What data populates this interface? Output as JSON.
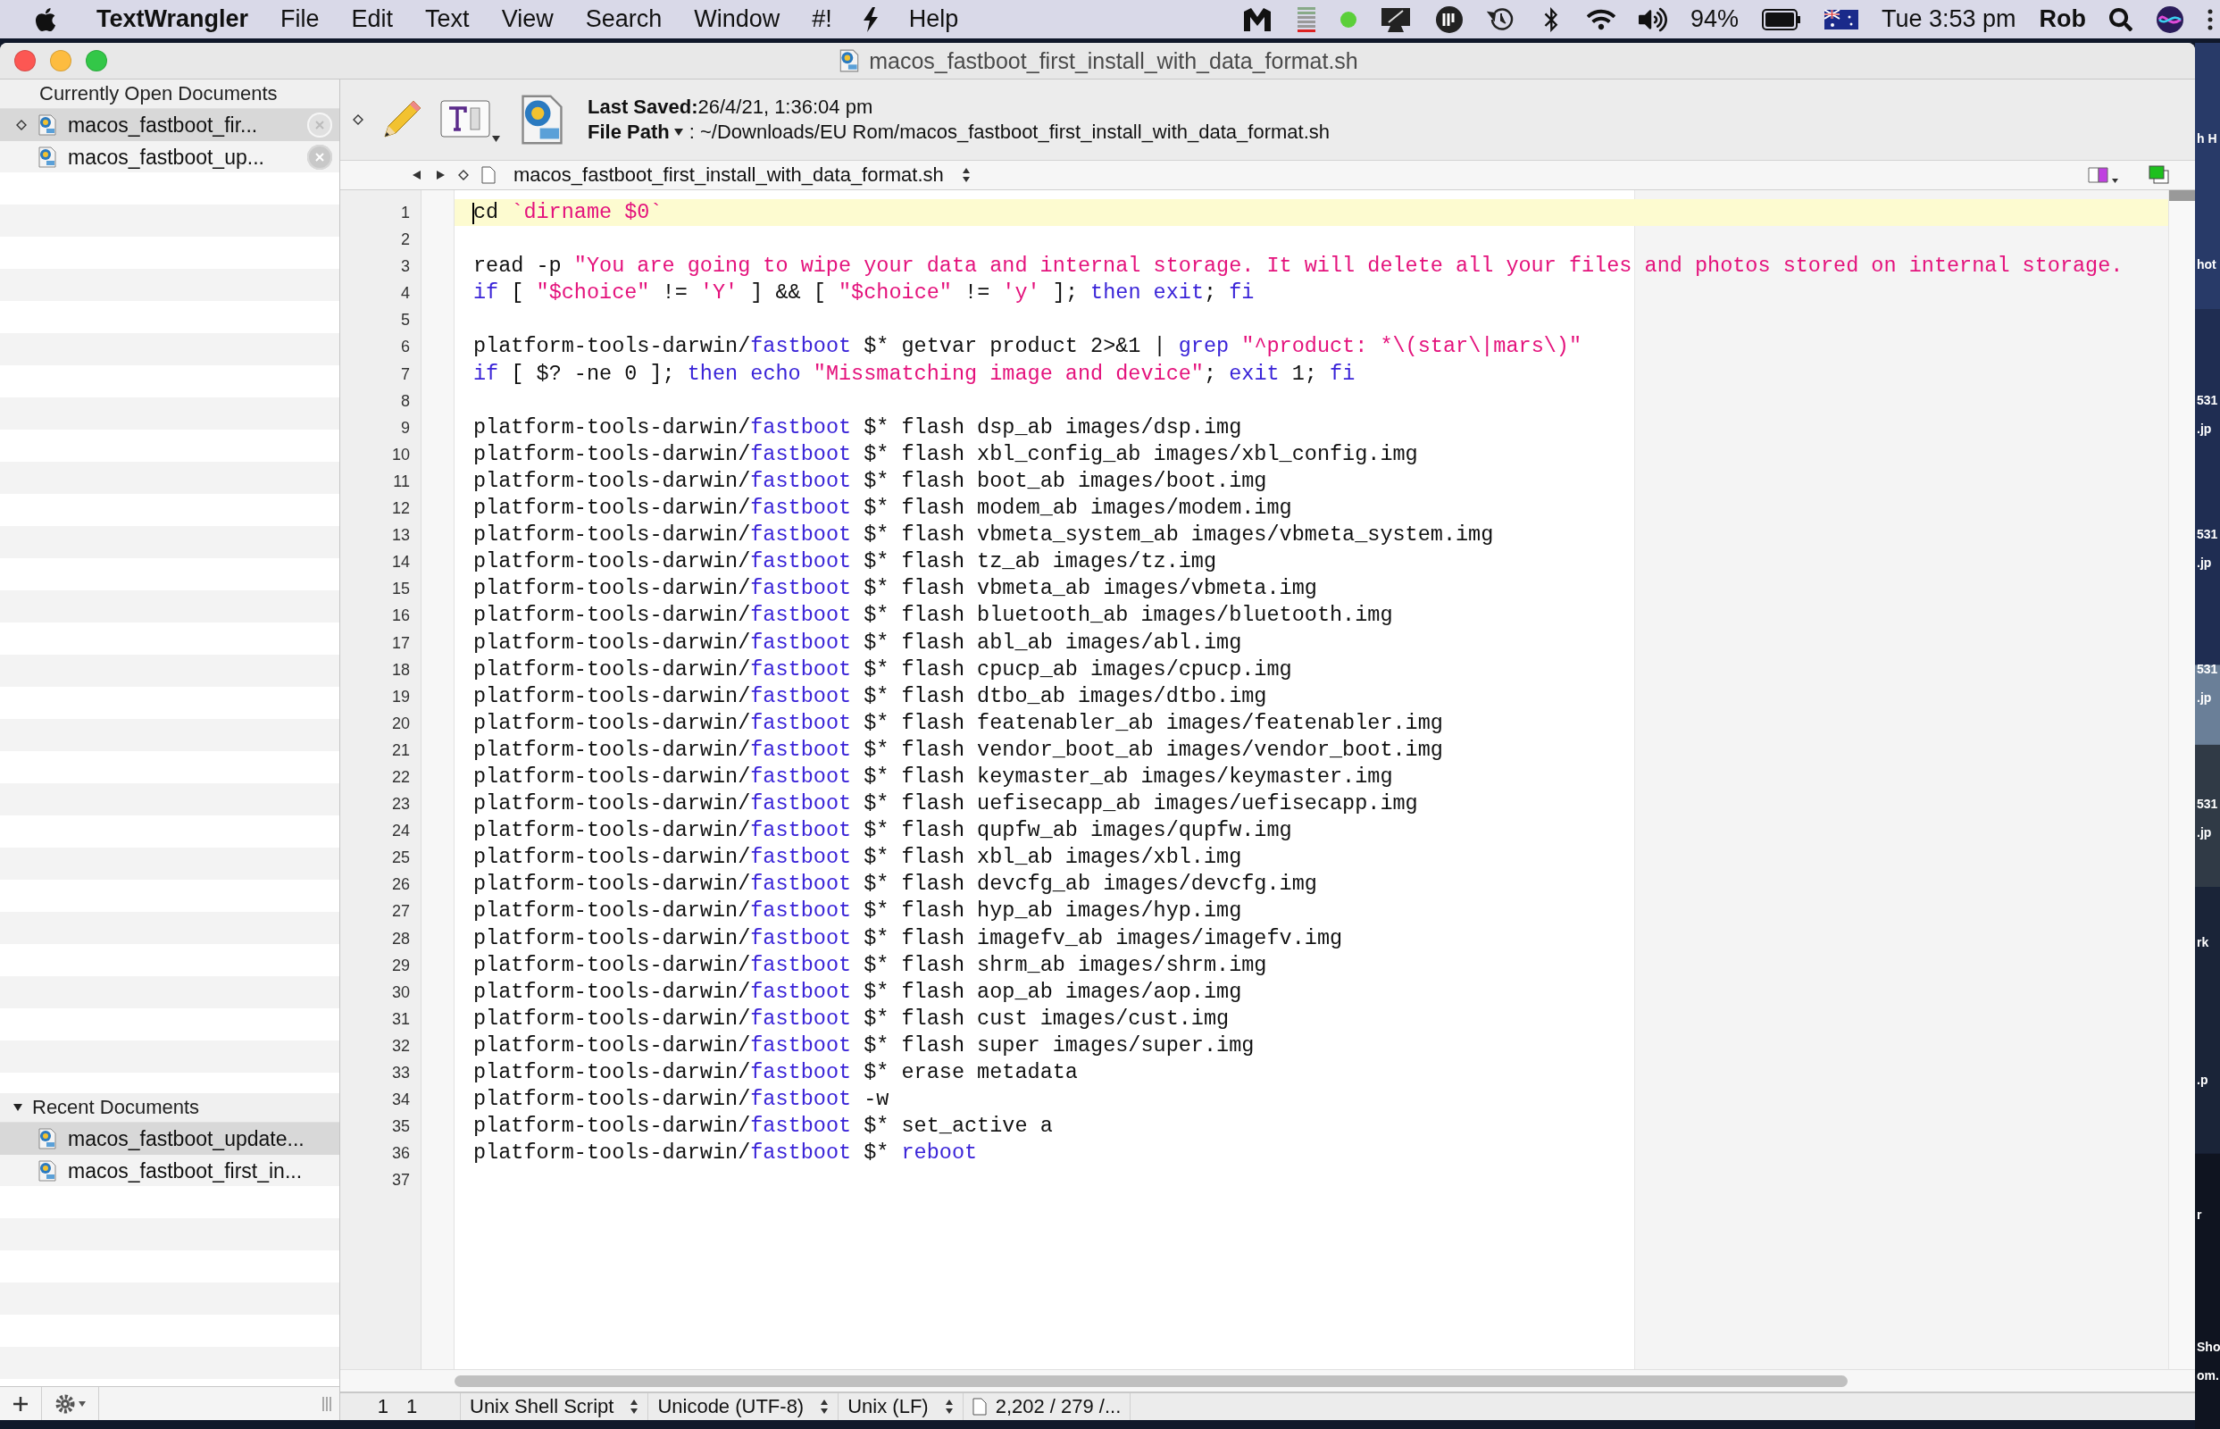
{
  "menubar": {
    "app_name": "TextWrangler",
    "menus": [
      "File",
      "Edit",
      "Text",
      "View",
      "Search",
      "Window",
      "#!"
    ],
    "help_menu": "Help",
    "battery": "94%",
    "clock": "Tue 3:53 pm",
    "user": "Rob"
  },
  "window": {
    "title": "macos_fastboot_first_install_with_data_format.sh"
  },
  "sidebar": {
    "open_header": "Currently Open Documents",
    "open_documents": [
      {
        "name": "macos_fastboot_fir...",
        "selected": true,
        "modified": true
      },
      {
        "name": "macos_fastboot_up...",
        "selected": false,
        "modified": false
      }
    ],
    "recent_header": "Recent Documents",
    "recent_expanded": true,
    "recent_documents": [
      {
        "name": "macos_fastboot_update...",
        "selected": true
      },
      {
        "name": "macos_fastboot_first_in...",
        "selected": false
      }
    ]
  },
  "toolbar": {
    "saved_label": "Last Saved:",
    "saved_value": " 26/4/21, 1:36:04 pm",
    "path_label": "File Path",
    "path_value": " : ~/Downloads/EU Rom/macos_fastboot_first_install_with_data_format.sh"
  },
  "navbar": {
    "file_name": "macos_fastboot_first_install_with_data_format.sh"
  },
  "code": [
    {
      "n": "1",
      "current": true,
      "tokens": [
        {
          "kind": "plain",
          "text": "cd "
        },
        {
          "kind": "string",
          "text": "`dirname $0`"
        }
      ]
    },
    {
      "n": "2",
      "current": false
    },
    {
      "n": "3",
      "current": false,
      "tokens": [
        {
          "kind": "plain",
          "text": "read -p "
        },
        {
          "kind": "string",
          "text": "\"You are going to wipe your data and internal storage. It will delete all your files and photos stored on internal storage."
        }
      ]
    },
    {
      "n": "4",
      "current": false,
      "tokens": [
        {
          "kind": "keyword",
          "text": "if"
        },
        {
          "kind": "plain",
          "text": " [ "
        },
        {
          "kind": "string",
          "text": "\"$choice\""
        },
        {
          "kind": "plain",
          "text": " != "
        },
        {
          "kind": "string",
          "text": "'Y'"
        },
        {
          "kind": "plain",
          "text": " ] && [ "
        },
        {
          "kind": "string",
          "text": "\"$choice\""
        },
        {
          "kind": "plain",
          "text": " != "
        },
        {
          "kind": "string",
          "text": "'y'"
        },
        {
          "kind": "plain",
          "text": " ]; "
        },
        {
          "kind": "keyword",
          "text": "then"
        },
        {
          "kind": "keyword",
          "text": " exit"
        },
        {
          "kind": "plain",
          "text": "; "
        },
        {
          "kind": "keyword",
          "text": "fi"
        }
      ]
    },
    {
      "n": "5",
      "current": false
    },
    {
      "n": "6",
      "current": false,
      "tokens": [
        {
          "kind": "plain",
          "text": "platform-tools-darwin/"
        },
        {
          "kind": "keyword",
          "text": "fastboot"
        },
        {
          "kind": "plain",
          "text": " $* getvar product 2>&1 | "
        },
        {
          "kind": "keyword",
          "text": "grep"
        },
        {
          "kind": "string",
          "text": " \"^product: *\\(star\\|mars\\)\""
        }
      ]
    },
    {
      "n": "7",
      "current": false,
      "tokens": [
        {
          "kind": "keyword",
          "text": "if"
        },
        {
          "kind": "plain",
          "text": " [ $? -ne 0 ]; "
        },
        {
          "kind": "keyword",
          "text": "then"
        },
        {
          "kind": "keyword",
          "text": " echo"
        },
        {
          "kind": "string",
          "text": " \"Missmatching image and device\""
        },
        {
          "kind": "plain",
          "text": "; "
        },
        {
          "kind": "keyword",
          "text": "exit"
        },
        {
          "kind": "plain",
          "text": " 1; "
        },
        {
          "kind": "keyword",
          "text": "fi"
        }
      ]
    },
    {
      "n": "8",
      "current": false
    },
    {
      "n": "9",
      "current": false,
      "tokens": [
        {
          "kind": "plain",
          "text": "platform-tools-darwin/"
        },
        {
          "kind": "keyword",
          "text": "fastboot"
        },
        {
          "kind": "plain",
          "text": " $* flash dsp_ab images/dsp.img"
        }
      ]
    },
    {
      "n": "10",
      "current": false,
      "tokens": [
        {
          "kind": "plain",
          "text": "platform-tools-darwin/"
        },
        {
          "kind": "keyword",
          "text": "fastboot"
        },
        {
          "kind": "plain",
          "text": " $* flash xbl_config_ab images/xbl_config.img"
        }
      ]
    },
    {
      "n": "11",
      "current": false,
      "tokens": [
        {
          "kind": "plain",
          "text": "platform-tools-darwin/"
        },
        {
          "kind": "keyword",
          "text": "fastboot"
        },
        {
          "kind": "plain",
          "text": " $* flash boot_ab images/boot.img"
        }
      ]
    },
    {
      "n": "12",
      "current": false,
      "tokens": [
        {
          "kind": "plain",
          "text": "platform-tools-darwin/"
        },
        {
          "kind": "keyword",
          "text": "fastboot"
        },
        {
          "kind": "plain",
          "text": " $* flash modem_ab images/modem.img"
        }
      ]
    },
    {
      "n": "13",
      "current": false,
      "tokens": [
        {
          "kind": "plain",
          "text": "platform-tools-darwin/"
        },
        {
          "kind": "keyword",
          "text": "fastboot"
        },
        {
          "kind": "plain",
          "text": " $* flash vbmeta_system_ab images/vbmeta_system.img"
        }
      ]
    },
    {
      "n": "14",
      "current": false,
      "tokens": [
        {
          "kind": "plain",
          "text": "platform-tools-darwin/"
        },
        {
          "kind": "keyword",
          "text": "fastboot"
        },
        {
          "kind": "plain",
          "text": " $* flash tz_ab images/tz.img"
        }
      ]
    },
    {
      "n": "15",
      "current": false,
      "tokens": [
        {
          "kind": "plain",
          "text": "platform-tools-darwin/"
        },
        {
          "kind": "keyword",
          "text": "fastboot"
        },
        {
          "kind": "plain",
          "text": " $* flash vbmeta_ab images/vbmeta.img"
        }
      ]
    },
    {
      "n": "16",
      "current": false,
      "tokens": [
        {
          "kind": "plain",
          "text": "platform-tools-darwin/"
        },
        {
          "kind": "keyword",
          "text": "fastboot"
        },
        {
          "kind": "plain",
          "text": " $* flash bluetooth_ab images/bluetooth.img"
        }
      ]
    },
    {
      "n": "17",
      "current": false,
      "tokens": [
        {
          "kind": "plain",
          "text": "platform-tools-darwin/"
        },
        {
          "kind": "keyword",
          "text": "fastboot"
        },
        {
          "kind": "plain",
          "text": " $* flash abl_ab images/abl.img"
        }
      ]
    },
    {
      "n": "18",
      "current": false,
      "tokens": [
        {
          "kind": "plain",
          "text": "platform-tools-darwin/"
        },
        {
          "kind": "keyword",
          "text": "fastboot"
        },
        {
          "kind": "plain",
          "text": " $* flash cpucp_ab images/cpucp.img"
        }
      ]
    },
    {
      "n": "19",
      "current": false,
      "tokens": [
        {
          "kind": "plain",
          "text": "platform-tools-darwin/"
        },
        {
          "kind": "keyword",
          "text": "fastboot"
        },
        {
          "kind": "plain",
          "text": " $* flash dtbo_ab images/dtbo.img"
        }
      ]
    },
    {
      "n": "20",
      "current": false,
      "tokens": [
        {
          "kind": "plain",
          "text": "platform-tools-darwin/"
        },
        {
          "kind": "keyword",
          "text": "fastboot"
        },
        {
          "kind": "plain",
          "text": " $* flash featenabler_ab images/featenabler.img"
        }
      ]
    },
    {
      "n": "21",
      "current": false,
      "tokens": [
        {
          "kind": "plain",
          "text": "platform-tools-darwin/"
        },
        {
          "kind": "keyword",
          "text": "fastboot"
        },
        {
          "kind": "plain",
          "text": " $* flash vendor_boot_ab images/vendor_boot.img"
        }
      ]
    },
    {
      "n": "22",
      "current": false,
      "tokens": [
        {
          "kind": "plain",
          "text": "platform-tools-darwin/"
        },
        {
          "kind": "keyword",
          "text": "fastboot"
        },
        {
          "kind": "plain",
          "text": " $* flash keymaster_ab images/keymaster.img"
        }
      ]
    },
    {
      "n": "23",
      "current": false,
      "tokens": [
        {
          "kind": "plain",
          "text": "platform-tools-darwin/"
        },
        {
          "kind": "keyword",
          "text": "fastboot"
        },
        {
          "kind": "plain",
          "text": " $* flash uefisecapp_ab images/uefisecapp.img"
        }
      ]
    },
    {
      "n": "24",
      "current": false,
      "tokens": [
        {
          "kind": "plain",
          "text": "platform-tools-darwin/"
        },
        {
          "kind": "keyword",
          "text": "fastboot"
        },
        {
          "kind": "plain",
          "text": " $* flash qupfw_ab images/qupfw.img"
        }
      ]
    },
    {
      "n": "25",
      "current": false,
      "tokens": [
        {
          "kind": "plain",
          "text": "platform-tools-darwin/"
        },
        {
          "kind": "keyword",
          "text": "fastboot"
        },
        {
          "kind": "plain",
          "text": " $* flash xbl_ab images/xbl.img"
        }
      ]
    },
    {
      "n": "26",
      "current": false,
      "tokens": [
        {
          "kind": "plain",
          "text": "platform-tools-darwin/"
        },
        {
          "kind": "keyword",
          "text": "fastboot"
        },
        {
          "kind": "plain",
          "text": " $* flash devcfg_ab images/devcfg.img"
        }
      ]
    },
    {
      "n": "27",
      "current": false,
      "tokens": [
        {
          "kind": "plain",
          "text": "platform-tools-darwin/"
        },
        {
          "kind": "keyword",
          "text": "fastboot"
        },
        {
          "kind": "plain",
          "text": " $* flash hyp_ab images/hyp.img"
        }
      ]
    },
    {
      "n": "28",
      "current": false,
      "tokens": [
        {
          "kind": "plain",
          "text": "platform-tools-darwin/"
        },
        {
          "kind": "keyword",
          "text": "fastboot"
        },
        {
          "kind": "plain",
          "text": " $* flash imagefv_ab images/imagefv.img"
        }
      ]
    },
    {
      "n": "29",
      "current": false,
      "tokens": [
        {
          "kind": "plain",
          "text": "platform-tools-darwin/"
        },
        {
          "kind": "keyword",
          "text": "fastboot"
        },
        {
          "kind": "plain",
          "text": " $* flash shrm_ab images/shrm.img"
        }
      ]
    },
    {
      "n": "30",
      "current": false,
      "tokens": [
        {
          "kind": "plain",
          "text": "platform-tools-darwin/"
        },
        {
          "kind": "keyword",
          "text": "fastboot"
        },
        {
          "kind": "plain",
          "text": " $* flash aop_ab images/aop.img"
        }
      ]
    },
    {
      "n": "31",
      "current": false,
      "tokens": [
        {
          "kind": "plain",
          "text": "platform-tools-darwin/"
        },
        {
          "kind": "keyword",
          "text": "fastboot"
        },
        {
          "kind": "plain",
          "text": " $* flash cust images/cust.img"
        }
      ]
    },
    {
      "n": "32",
      "current": false,
      "tokens": [
        {
          "kind": "plain",
          "text": "platform-tools-darwin/"
        },
        {
          "kind": "keyword",
          "text": "fastboot"
        },
        {
          "kind": "plain",
          "text": " $* flash super images/super.img"
        }
      ]
    },
    {
      "n": "33",
      "current": false,
      "tokens": [
        {
          "kind": "plain",
          "text": "platform-tools-darwin/"
        },
        {
          "kind": "keyword",
          "text": "fastboot"
        },
        {
          "kind": "plain",
          "text": " $* erase metadata"
        }
      ]
    },
    {
      "n": "34",
      "current": false,
      "tokens": [
        {
          "kind": "plain",
          "text": "platform-tools-darwin/"
        },
        {
          "kind": "keyword",
          "text": "fastboot"
        },
        {
          "kind": "plain",
          "text": " -w"
        }
      ]
    },
    {
      "n": "35",
      "current": false,
      "tokens": [
        {
          "kind": "plain",
          "text": "platform-tools-darwin/"
        },
        {
          "kind": "keyword",
          "text": "fastboot"
        },
        {
          "kind": "plain",
          "text": " $* set_active a"
        }
      ]
    },
    {
      "n": "36",
      "current": false,
      "tokens": [
        {
          "kind": "plain",
          "text": "platform-tools-darwin/"
        },
        {
          "kind": "keyword",
          "text": "fastboot"
        },
        {
          "kind": "plain",
          "text": " $* "
        },
        {
          "kind": "keyword",
          "text": "reboot"
        }
      ]
    },
    {
      "n": "37",
      "current": false
    }
  ],
  "status_bar": {
    "line": "1",
    "column": "1",
    "language": "Unix Shell Script",
    "encoding": "Unicode (UTF-8)",
    "line_endings": "Unix (LF)",
    "counts": "2,202 / 279 /..."
  },
  "desktop_labels": [
    "h H",
    "hot",
    "531",
    ".jp",
    "531",
    ".jp",
    "531",
    ".jp",
    "531",
    ".jp",
    "rk",
    ".p",
    "r",
    "Sho",
    "om."
  ]
}
